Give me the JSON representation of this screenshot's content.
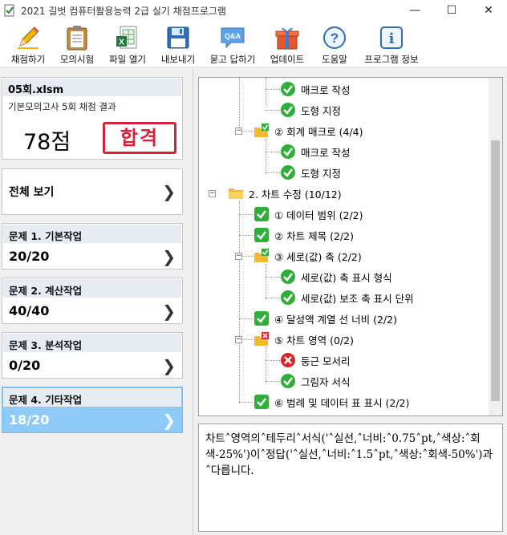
{
  "window": {
    "title": "2021 길벗 컴퓨터활용능력 2급 실기 채점프로그램",
    "minimize": "—",
    "maximize": "☐",
    "close": "✕"
  },
  "toolbar": [
    {
      "label": "채점하기",
      "icon": "pencil-icon"
    },
    {
      "label": "모의시험",
      "icon": "clipboard-icon"
    },
    {
      "label": "파일 열기",
      "icon": "excel-file-icon"
    },
    {
      "label": "내보내기",
      "icon": "floppy-disk-icon"
    },
    {
      "label": "묻고 답하기",
      "icon": "qa-bubble-icon"
    },
    {
      "label": "업데이트",
      "icon": "gift-icon"
    },
    {
      "label": "도움말",
      "icon": "help-icon"
    },
    {
      "label": "프로그램 정보",
      "icon": "info-icon"
    }
  ],
  "file": {
    "name": "05회.xlsm",
    "subtitle": "기본모의고사 5회 채점 결과",
    "score": "78점",
    "stamp": "합격"
  },
  "full_view": "전체 보기",
  "problems": [
    {
      "title": "문제 1. 기본작업",
      "score": "20/20"
    },
    {
      "title": "문제 2. 계산작업",
      "score": "40/40"
    },
    {
      "title": "문제 3. 분석작업",
      "score": "0/20"
    },
    {
      "title": "문제 4. 기타작업",
      "score": "18/20"
    }
  ],
  "tree": [
    {
      "label": "매크로 작성",
      "status": "pass"
    },
    {
      "label": "도형 지정",
      "status": "pass"
    },
    {
      "label": "② 회계 매크로 (4/4)",
      "status": "folder-pass"
    },
    {
      "label": "매크로 작성",
      "status": "pass"
    },
    {
      "label": "도형 지정",
      "status": "pass"
    },
    {
      "label": "2. 차트 수정 (10/12)",
      "status": "folder"
    },
    {
      "label": "① 데이터 범위 (2/2)",
      "status": "pass"
    },
    {
      "label": "② 차트 제목 (2/2)",
      "status": "pass"
    },
    {
      "label": "③ 세로(값) 축 (2/2)",
      "status": "folder-pass"
    },
    {
      "label": "세로(값) 축 표시 형식",
      "status": "pass"
    },
    {
      "label": "세로(값) 보조 축 표시 단위",
      "status": "pass"
    },
    {
      "label": "④ 달성액 계열 선 너비 (2/2)",
      "status": "pass"
    },
    {
      "label": "⑤ 차트 영역 (0/2)",
      "status": "folder-fail"
    },
    {
      "label": "둥근 모서리",
      "status": "fail"
    },
    {
      "label": "그림자 서식",
      "status": "pass"
    },
    {
      "label": "⑥ 범례 및 데이터 표 표시 (2/2)",
      "status": "pass"
    }
  ],
  "message": "차트˄영역의˄테두리˄서식('˄실선,˄너비:˄0.75˄pt,˄색상:˄회색-25%')이˄정답('˄실선,˄너비:˄1.5˄pt,˄색상:˄회색-50%')과˄다릅니다."
}
